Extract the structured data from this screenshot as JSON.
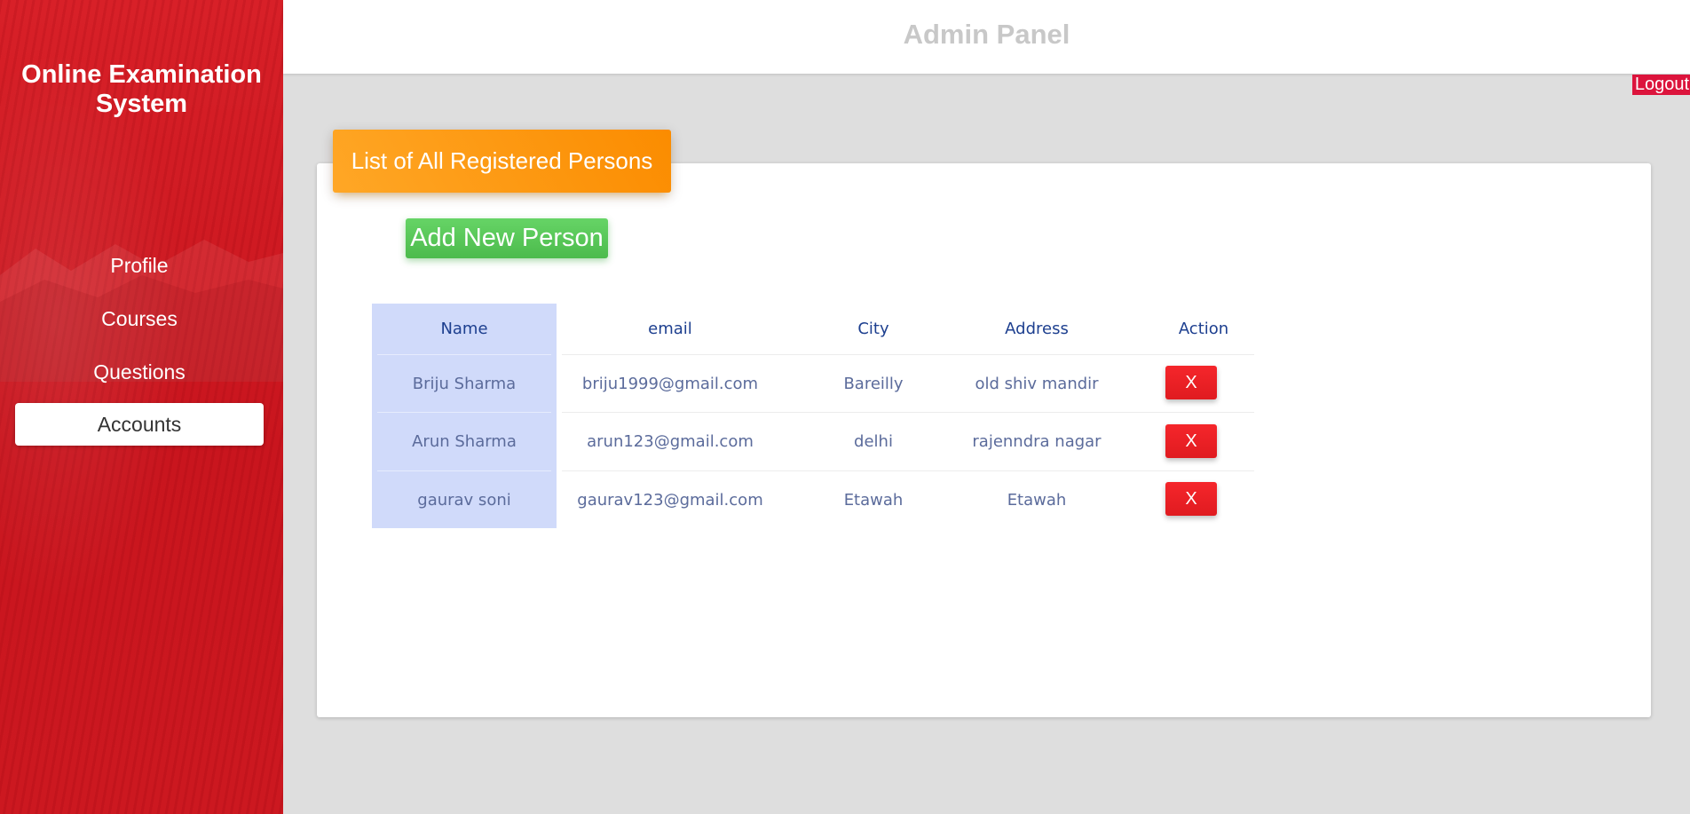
{
  "sidebar": {
    "brand_line1": "Online Examination",
    "brand_line2": "System",
    "items": [
      {
        "label": "Profile"
      },
      {
        "label": "Courses"
      },
      {
        "label": "Questions"
      },
      {
        "label": "Accounts"
      }
    ]
  },
  "topbar": {
    "title": "Admin Panel",
    "logout_label": "Logout"
  },
  "card": {
    "header": "List of All Registered Persons",
    "add_button": "Add New Person"
  },
  "table": {
    "columns": [
      "Name",
      "email",
      "City",
      "Address",
      "Action"
    ],
    "rows": [
      {
        "name": "Briju Sharma",
        "email": "briju1999@gmail.com",
        "city": "Bareilly",
        "address": "old shiv mandir",
        "action": "X"
      },
      {
        "name": "Arun Sharma",
        "email": "arun123@gmail.com",
        "city": "delhi",
        "address": "rajenndra nagar",
        "action": "X"
      },
      {
        "name": "gaurav soni",
        "email": "gaurav123@gmail.com",
        "city": "Etawah",
        "address": "Etawah",
        "action": "X"
      }
    ]
  },
  "colors": {
    "sidebar_red": "#d01c24",
    "header_orange": "#fb8c00",
    "add_green": "#4cbb4c",
    "delete_red": "#e01b20",
    "logout_crimson": "#dc143c",
    "name_column_bg": "#d0dafa"
  }
}
